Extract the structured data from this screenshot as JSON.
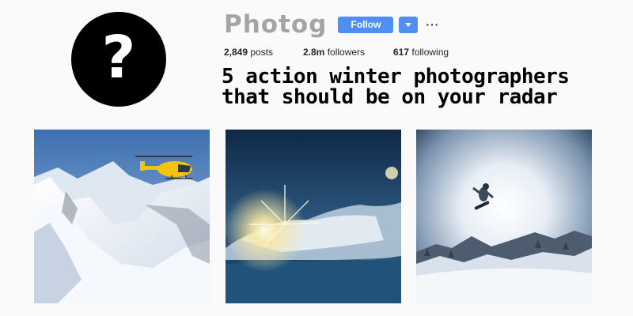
{
  "profile": {
    "avatar_glyph": "?",
    "username": "Photog",
    "follow_label": "Follow",
    "more_label": "···",
    "accent_color": "#4f8ff0"
  },
  "stats": {
    "posts": {
      "value": "2,849",
      "label": "posts"
    },
    "followers": {
      "value": "2.8m",
      "label": "followers"
    },
    "following": {
      "value": "617",
      "label": "following"
    }
  },
  "headline": {
    "line1": "5 action winter photographers",
    "line2": "that should be on your radar"
  },
  "photos": [
    {
      "subject": "helicopter-over-snowy-mountains"
    },
    {
      "subject": "snow-spray-sunburst"
    },
    {
      "subject": "snowboarder-midair"
    }
  ]
}
